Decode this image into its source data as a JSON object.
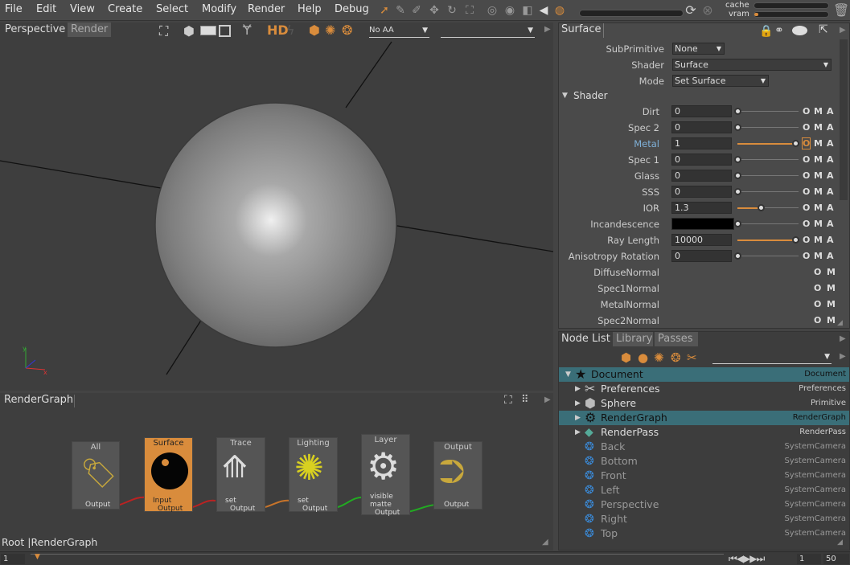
{
  "menubar": {
    "items": [
      "File",
      "Edit",
      "View",
      "Create",
      "Select",
      "Modify",
      "Render",
      "Help",
      "Debug"
    ],
    "cache_label": "cache",
    "vram_label": "vram"
  },
  "viewport": {
    "tabs": [
      "Perspective",
      "Render"
    ],
    "aa_combo": "No AA",
    "hd_label": "HD",
    "axis_x": "x",
    "axis_y": "y"
  },
  "rendergraph": {
    "title": "RenderGraph",
    "breadcrumb": "Root |RenderGraph",
    "nodes": [
      {
        "title": "All",
        "ports": [
          "Output"
        ]
      },
      {
        "title": "Surface",
        "ports": [
          "Input",
          "Output"
        ]
      },
      {
        "title": "Trace",
        "ports": [
          "set",
          "Output"
        ]
      },
      {
        "title": "Lighting",
        "ports": [
          "set",
          "Output"
        ]
      },
      {
        "title": "Layer",
        "ports": [
          "visible",
          "matte",
          "Output"
        ]
      },
      {
        "title": "Output",
        "ports": [
          "Output"
        ]
      }
    ]
  },
  "properties": {
    "tab": "Surface",
    "subprimitive_label": "SubPrimitive",
    "subprimitive_value": "None",
    "shader_label": "Shader",
    "shader_value": "Surface",
    "mode_label": "Mode",
    "mode_value": "Set Surface",
    "section": "Shader",
    "rows": [
      {
        "label": "Dirt",
        "value": "0",
        "fill": 0.0
      },
      {
        "label": "Spec 2",
        "value": "0",
        "fill": 0.0
      },
      {
        "label": "Metal",
        "value": "1",
        "fill": 1.0
      },
      {
        "label": "Spec 1",
        "value": "0",
        "fill": 0.0
      },
      {
        "label": "Glass",
        "value": "0",
        "fill": 0.0
      },
      {
        "label": "SSS",
        "value": "0",
        "fill": 0.0
      },
      {
        "label": "IOR",
        "value": "1.3",
        "fill": 0.4
      },
      {
        "label": "Incandescence",
        "value": "",
        "fill": 0.0
      },
      {
        "label": "Ray Length",
        "value": "10000",
        "fill": 1.0
      },
      {
        "label": "Anisotropy Rotation",
        "value": "0",
        "fill": 0.0
      }
    ],
    "normal_rows": [
      "DiffuseNormal",
      "Spec1Normal",
      "MetalNormal",
      "Spec2Normal"
    ],
    "o": "O",
    "m": "M",
    "a": "A"
  },
  "nodelist": {
    "tabs": [
      "Node List",
      "Library",
      "Passes"
    ],
    "rows": [
      {
        "name": "Document",
        "type": "Document"
      },
      {
        "name": "Preferences",
        "type": "Preferences"
      },
      {
        "name": "Sphere",
        "type": "Primitive"
      },
      {
        "name": "RenderGraph",
        "type": "RenderGraph"
      },
      {
        "name": "RenderPass",
        "type": "RenderPass"
      },
      {
        "name": "Back",
        "type": "SystemCamera"
      },
      {
        "name": "Bottom",
        "type": "SystemCamera"
      },
      {
        "name": "Front",
        "type": "SystemCamera"
      },
      {
        "name": "Left",
        "type": "SystemCamera"
      },
      {
        "name": "Perspective",
        "type": "SystemCamera"
      },
      {
        "name": "Right",
        "type": "SystemCamera"
      },
      {
        "name": "Top",
        "type": "SystemCamera"
      }
    ]
  },
  "timeline": {
    "start": "1",
    "current": "1",
    "end": "50"
  },
  "colors": {
    "accent": "#d98c3c",
    "selection": "#3a6e78",
    "metal_label": "#7fb0d8"
  }
}
